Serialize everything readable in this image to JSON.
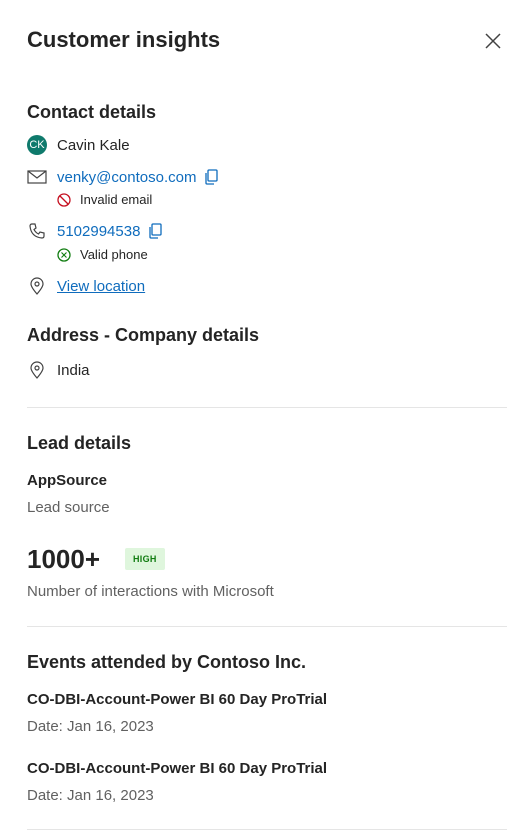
{
  "panel": {
    "title": "Customer insights",
    "close_icon": "close-icon"
  },
  "contact": {
    "heading": "Contact details",
    "avatar_initials": "CK",
    "name": "Cavin Kale",
    "email": "venky@contoso.com",
    "email_status": "Invalid email",
    "phone": "5102994538",
    "phone_status": "Valid phone",
    "location_link": "View location",
    "icons": [
      "mail-icon",
      "phone-icon",
      "location-pin-icon",
      "copy-icon",
      "blocked-icon",
      "check-circle-icon"
    ]
  },
  "address": {
    "heading": "Address - Company details",
    "country": "India"
  },
  "lead": {
    "heading": "Lead details",
    "source_value": "AppSource",
    "source_label": "Lead source",
    "interactions_value": "1000+",
    "interactions_badge": "HIGH",
    "interactions_label": "Number of interactions with Microsoft"
  },
  "events": {
    "heading": "Events attended by Contoso Inc.",
    "items": [
      {
        "name": "CO-DBI-Account-Power BI 60 Day ProTrial",
        "date": "Date: Jan 16, 2023"
      },
      {
        "name": "CO-DBI-Account-Power BI 60 Day ProTrial",
        "date": "Date: Jan 16, 2023"
      }
    ]
  },
  "colors": {
    "link": "#0f6cbd",
    "avatar_bg": "#0f7a6c",
    "invalid": "#c50f1f",
    "valid": "#107c10",
    "badge_bg": "#dff6dd"
  }
}
